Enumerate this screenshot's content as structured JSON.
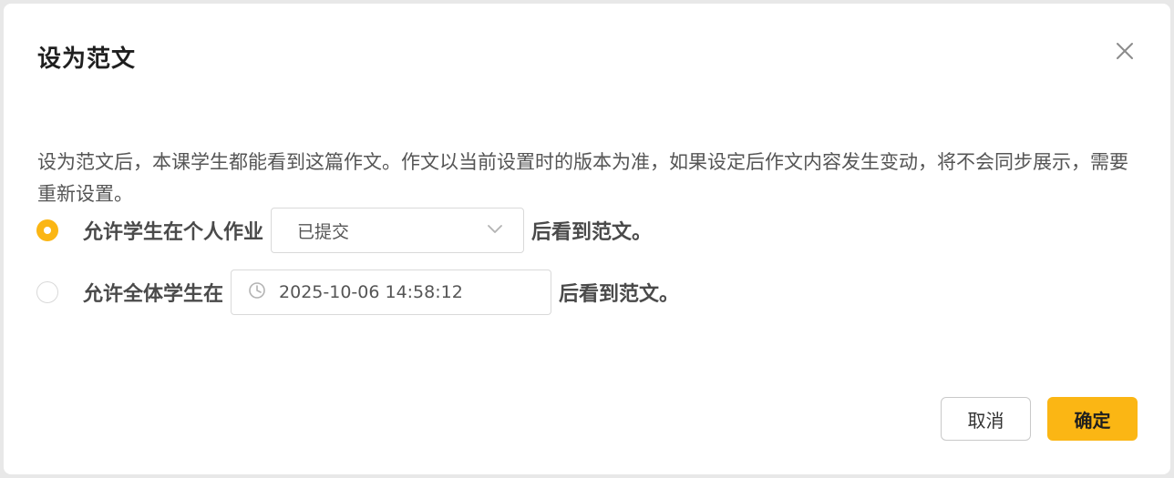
{
  "dialog": {
    "title": "设为范文",
    "close_icon": "close-icon",
    "description": "设为范文后，本课学生都能看到这篇作文。作文以当前设置时的版本为准，如果设定后作文内容发生变动，将不会同步展示，需要重新设置。",
    "options": [
      {
        "label": "允许学生在个人作业",
        "selected": true,
        "control": "select",
        "value": "已提交",
        "suffix": "后看到范文。"
      },
      {
        "label": "允许全体学生在",
        "selected": false,
        "control": "datetime",
        "value": "2025-10-06 14:58:12",
        "suffix": "后看到范文。"
      }
    ],
    "cancel_label": "取消",
    "ok_label": "确定"
  },
  "colors": {
    "accent": "#fbb614",
    "text_primary": "#1f1f1f",
    "text_secondary": "#555555",
    "border": "#d9d9d9"
  },
  "icons": [
    "close-icon",
    "chevron-down-icon",
    "clock-icon"
  ]
}
